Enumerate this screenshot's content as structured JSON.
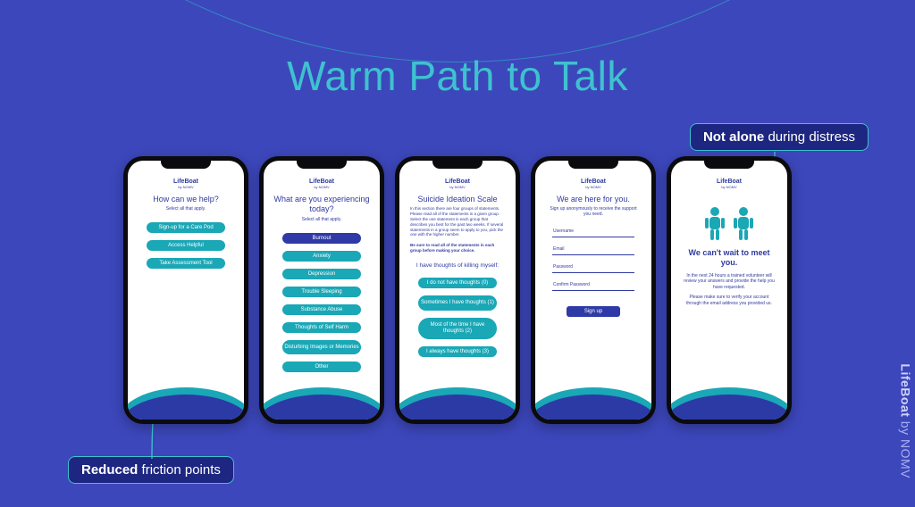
{
  "slide": {
    "title": "Warm Path to Talk"
  },
  "callouts": {
    "top_bold": "Not alone",
    "top_rest": " during distress",
    "bottom_bold": "Reduced",
    "bottom_rest": " friction points"
  },
  "brand": {
    "app_name": "LifeBoat",
    "app_by": "by NOMV",
    "side_main": "LifeBoat",
    "side_rest": " by NOMV"
  },
  "phone1": {
    "title": "How can we help?",
    "sub": "Select all that apply.",
    "opt1": "Sign-up for a Care Pod",
    "opt2": "Access Helpful",
    "opt3": "Take Assessment Tool"
  },
  "phone2": {
    "title": "What are you experiencing today?",
    "sub": "Select all that apply.",
    "o1": "Burnout",
    "o2": "Anxiety",
    "o3": "Depression",
    "o4": "Trouble Sleeping",
    "o5": "Substance Abuse",
    "o6": "Thoughts of Self Harm",
    "o7": "Disturbing Images or Memories",
    "o8": "Other"
  },
  "phone3": {
    "title": "Suicide Ideation Scale",
    "para": "In this section there are four groups of statements. Please read all of the statements in a given group. Select the one statement in each group that describes you best for the past two weeks. If several statements in a group seem to apply to you, pick the one with the higher number.",
    "bold_note": "Be sure to read all of the statements in each group before making your choice.",
    "question": "I have thoughts of killing myself:",
    "a1": "I do not have thoughts (0)",
    "a2": "Sometimes I have thoughts (1)",
    "a3": "Most of the time I have thoughts (2)",
    "a4": "I always have thoughts (3)"
  },
  "phone4": {
    "title": "We are here for you.",
    "sub": "Sign up anonymously to receive the support you need.",
    "f1": "Username",
    "f2": "Email",
    "f3": "Password",
    "f4": "Confirm Password",
    "btn": "Sign up"
  },
  "phone5": {
    "title": "We can't wait to meet you.",
    "p1": "In the next 24 hours a trained volunteer will review your answers and provide the help you have requested.",
    "p2": "Please make sure to verify your account through the email address you provided us."
  }
}
